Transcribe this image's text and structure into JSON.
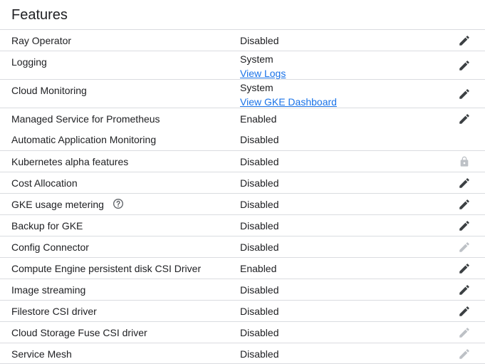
{
  "section": {
    "title": "Features"
  },
  "colors": {
    "link": "#1a73e8",
    "divider": "#dadce0",
    "icon_enabled": "#3c4043",
    "icon_disabled": "#bdc1c6"
  },
  "rows": [
    {
      "label": "Ray Operator",
      "value": "Disabled",
      "icon": "edit-icon"
    },
    {
      "label": "Logging",
      "value": "System",
      "link": "View Logs",
      "icon": "edit-icon"
    },
    {
      "label": "Cloud Monitoring",
      "value": "System",
      "link": "View GKE Dashboard",
      "icon": "edit-icon"
    },
    {
      "label": "Managed Service for Prometheus",
      "value": "Enabled",
      "icon": "edit-icon"
    },
    {
      "label": "Automatic Application Monitoring",
      "value": "Disabled"
    },
    {
      "label": "Kubernetes alpha features",
      "value": "Disabled",
      "icon": "lock-icon"
    },
    {
      "label": "Cost Allocation",
      "value": "Disabled",
      "icon": "edit-icon"
    },
    {
      "label": "GKE usage metering",
      "value": "Disabled",
      "icon": "edit-icon",
      "help": "help-icon"
    },
    {
      "label": "Backup for GKE",
      "value": "Disabled",
      "icon": "edit-icon"
    },
    {
      "label": "Config Connector",
      "value": "Disabled",
      "icon": "edit-icon-disabled"
    },
    {
      "label": "Compute Engine persistent disk CSI Driver",
      "value": "Enabled",
      "icon": "edit-icon"
    },
    {
      "label": "Image streaming",
      "value": "Disabled",
      "icon": "edit-icon"
    },
    {
      "label": "Filestore CSI driver",
      "value": "Disabled",
      "icon": "edit-icon"
    },
    {
      "label": "Cloud Storage Fuse CSI driver",
      "value": "Disabled",
      "icon": "edit-icon-disabled"
    },
    {
      "label": "Service Mesh",
      "value": "Disabled",
      "icon": "edit-icon-disabled"
    }
  ]
}
